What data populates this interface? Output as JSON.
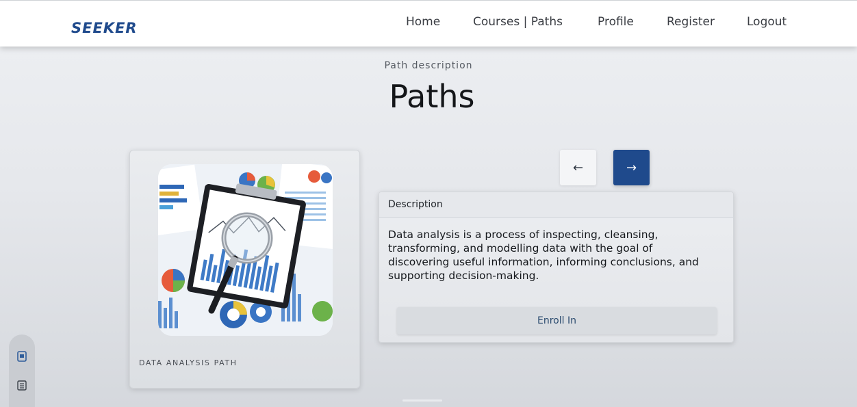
{
  "nav": {
    "logo": "SEEKER",
    "links": [
      "Home",
      "Courses | Paths",
      "Profile",
      "Register",
      "Logout"
    ]
  },
  "header": {
    "eyebrow": "Path description",
    "title": "Paths"
  },
  "path_card": {
    "label": "DATA ANALYSIS PATH",
    "image": "data-analysis-image"
  },
  "carousel": {
    "prev_icon": "arrow-left-icon",
    "next_icon": "arrow-right-icon",
    "prev_glyph": "←",
    "next_glyph": "→"
  },
  "description": {
    "heading": "Description",
    "text": "Data analysis is a process of inspecting, cleansing, transforming, and modelling data with the goal of discovering useful information, informing conclusions, and supporting decision-making.",
    "enroll_label": "Enroll In"
  },
  "colors": {
    "brand": "#1f4a8c",
    "background": "#e6e8ec",
    "card": "#e3e5e9"
  }
}
